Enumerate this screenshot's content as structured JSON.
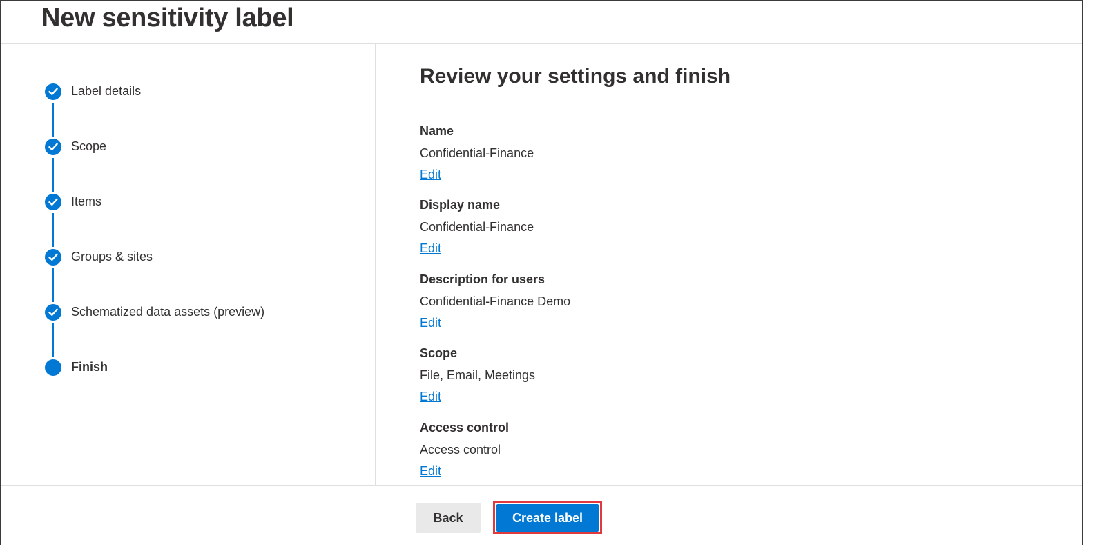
{
  "page": {
    "title": "New sensitivity label"
  },
  "steps": [
    {
      "label": "Label details",
      "state": "complete"
    },
    {
      "label": "Scope",
      "state": "complete"
    },
    {
      "label": "Items",
      "state": "complete"
    },
    {
      "label": "Groups & sites",
      "state": "complete"
    },
    {
      "label": "Schematized data assets (preview)",
      "state": "complete"
    },
    {
      "label": "Finish",
      "state": "current"
    }
  ],
  "review": {
    "title": "Review your settings and finish",
    "sections": [
      {
        "heading": "Name",
        "value": "Confidential-Finance",
        "edit": "Edit"
      },
      {
        "heading": "Display name",
        "value": "Confidential-Finance",
        "edit": "Edit"
      },
      {
        "heading": "Description for users",
        "value": "Confidential-Finance Demo",
        "edit": "Edit"
      },
      {
        "heading": "Scope",
        "value": "File, Email, Meetings",
        "edit": "Edit"
      },
      {
        "heading": "Access control",
        "value": "Access control",
        "edit": "Edit"
      }
    ]
  },
  "footer": {
    "back_label": "Back",
    "create_label": "Create label"
  },
  "colors": {
    "accent": "#0078d4",
    "highlight": "#e0393e",
    "text": "#323130"
  },
  "icons": {
    "step_complete": "checkmark-icon",
    "step_current": "current-step-dot-icon"
  }
}
